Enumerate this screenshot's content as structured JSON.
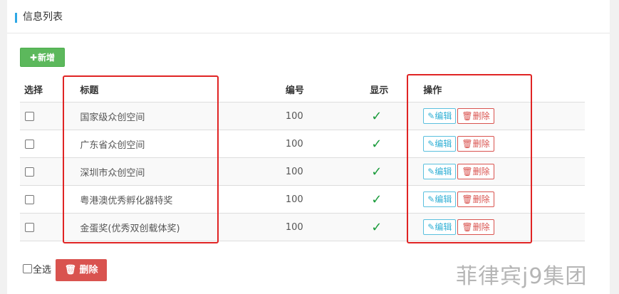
{
  "panel": {
    "title": "信息列表"
  },
  "toolbar": {
    "add_label": "新增",
    "add_icon": "plus-icon"
  },
  "table": {
    "headers": {
      "select": "选择",
      "title": "标题",
      "number": "编号",
      "display": "显示",
      "actions": "操作"
    },
    "rows": [
      {
        "title": "国家级众创空间",
        "number": "100",
        "display": "✓"
      },
      {
        "title": "广东省众创空间",
        "number": "100",
        "display": "✓"
      },
      {
        "title": "深圳市众创空间",
        "number": "100",
        "display": "✓"
      },
      {
        "title": "粤港澳优秀孵化器特奖",
        "number": "100",
        "display": "✓"
      },
      {
        "title": "金蛋奖(优秀双创载体奖)",
        "number": "100",
        "display": "✓"
      }
    ],
    "edit_label": "编辑",
    "delete_label": "删除"
  },
  "footer": {
    "select_all_label": "全选",
    "bulk_delete_label": "删除"
  },
  "watermark": "菲律宾j9集团",
  "colors": {
    "accent": "#2ea8e5",
    "add": "#5cb85c",
    "danger": "#d9534f",
    "info": "#5bc0de",
    "highlight": "#e02424"
  }
}
